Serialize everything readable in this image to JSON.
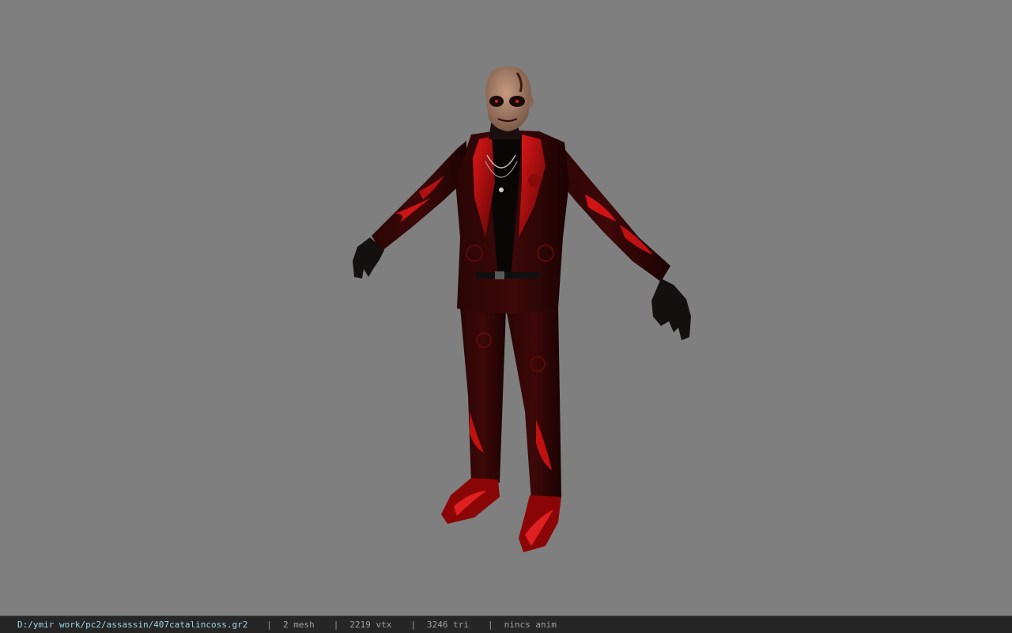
{
  "viewport": {
    "background": "#7f7f7f",
    "model_name": "407catalincoss"
  },
  "statusbar": {
    "file_path": "D:/ymir work/pc2/assassin/407catalincoss.gr2",
    "separator": "|",
    "mesh_count": "2 mesh",
    "vertex_count": "2219 vtx",
    "triangle_count": "3246 tri",
    "anim_status": "nincs anim"
  },
  "colors": {
    "path_text": "#9fd4e6",
    "stat_text": "#a0a0a0",
    "bar_bg": "#262626",
    "suit_red": "#c01010",
    "suit_dark": "#1a0404"
  }
}
